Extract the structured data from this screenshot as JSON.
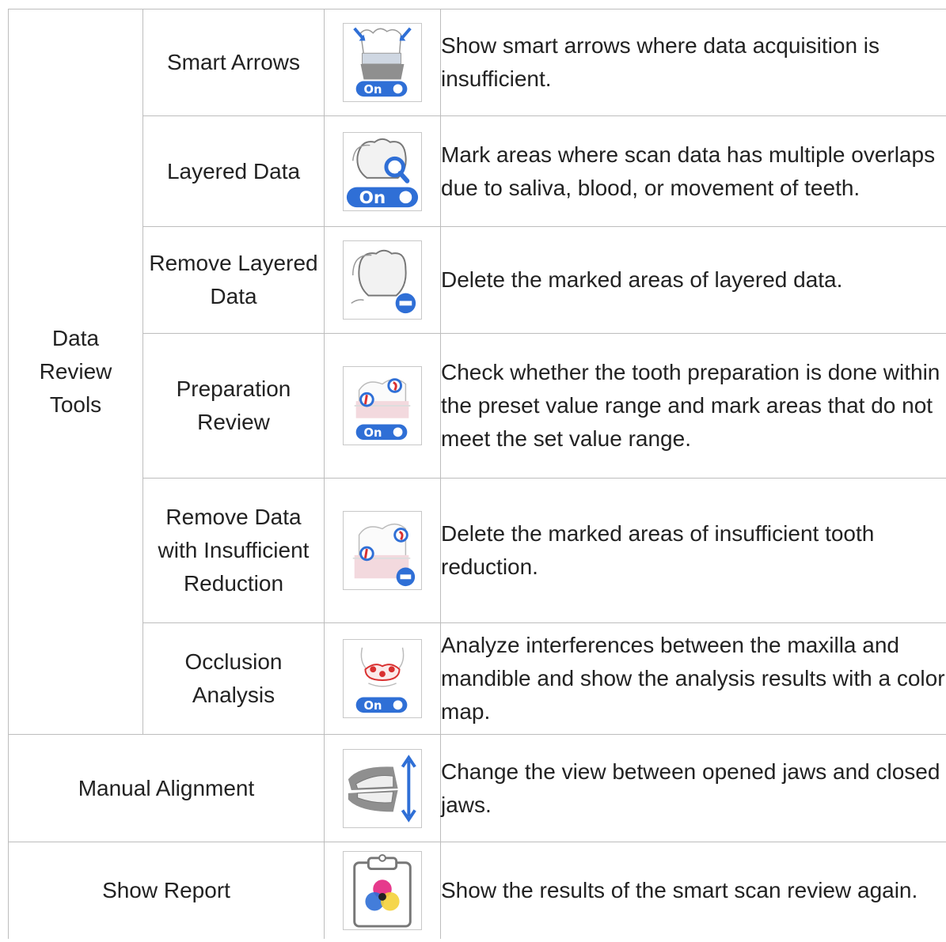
{
  "group": {
    "label": "Data Review Tools"
  },
  "rows": [
    {
      "name": "Smart Arrows",
      "icon": "smart-arrows-icon",
      "desc": "Show smart arrows where data acquisition is insufficient.",
      "toggle": "On"
    },
    {
      "name": "Layered Data",
      "icon": "layered-data-icon",
      "desc": "Mark areas where scan data has multiple overlaps due to saliva, blood, or movement of teeth.",
      "toggle": "On"
    },
    {
      "name": "Remove Layered Data",
      "icon": "remove-layered-data-icon",
      "desc": "Delete the marked areas of layered data."
    },
    {
      "name": "Preparation Review",
      "icon": "preparation-review-icon",
      "desc": "Check whether the tooth preparation is done within the preset value range and mark areas that do not meet the set value range.",
      "toggle": "On"
    },
    {
      "name": "Remove Data with Insufficient Reduction",
      "icon": "remove-insufficient-reduction-icon",
      "desc": "Delete the marked areas of insufficient tooth reduction."
    },
    {
      "name": "Occlusion Analysis",
      "icon": "occlusion-analysis-icon",
      "desc": "Analyze interferences between the maxilla and mandible and show the analysis results with a color map.",
      "toggle": "On"
    },
    {
      "name": "Manual Alignment",
      "icon": "manual-alignment-icon",
      "desc": "Change the view between opened jaws and closed jaws."
    },
    {
      "name": "Show Report",
      "icon": "show-report-icon",
      "desc": "Show the results of the smart scan review again."
    }
  ],
  "colors": {
    "border": "#bdbdbd",
    "accent": "#2f6fd6",
    "red": "#d93030",
    "text": "#222222"
  }
}
